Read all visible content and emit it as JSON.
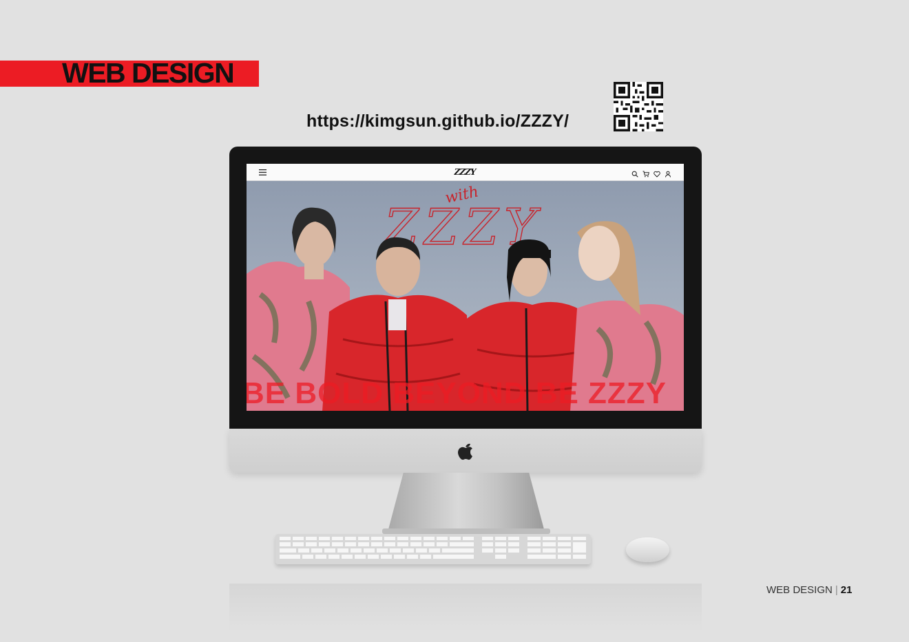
{
  "header": {
    "title": "WEB DESIGN",
    "url": "https://kimgsun.github.io/ZZZY/"
  },
  "site": {
    "logo": "ZZZY",
    "hero_script_top": "with",
    "hero_script_main": "ZZZY",
    "hero_slogan": "BE BOLD BEYOND BE ZZZY"
  },
  "footer": {
    "section": "WEB DESIGN",
    "separator": "|",
    "page_number": "21"
  },
  "icons": {
    "nav_left": "menu-icon",
    "nav_right": [
      "search-icon",
      "cart-icon",
      "heart-icon",
      "user-icon"
    ],
    "qr": "qr-code-icon",
    "brand": "apple-logo-icon"
  },
  "colors": {
    "accent_red": "#ec1c24",
    "background": "#e1e1e1",
    "jacket_red": "#d8262b",
    "jacket_pink": "#e07a8e"
  }
}
